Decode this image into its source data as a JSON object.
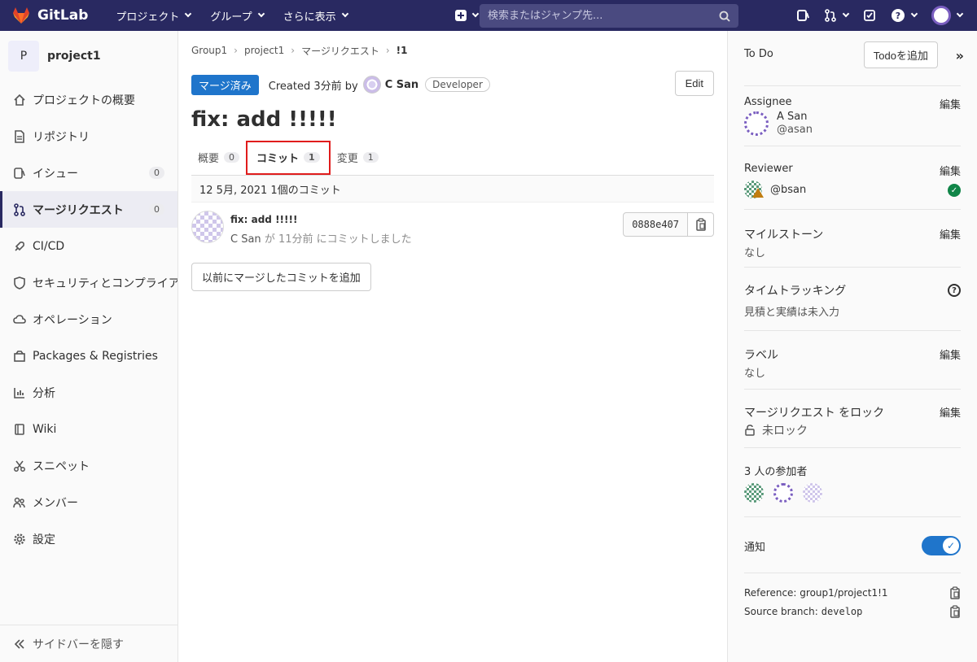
{
  "navbar": {
    "brand": "GitLab",
    "menu": [
      {
        "label": "プロジェクト"
      },
      {
        "label": "グループ"
      },
      {
        "label": "さらに表示"
      }
    ],
    "search_placeholder": "検索またはジャンプ先..."
  },
  "sidebar": {
    "project_initial": "P",
    "project_name": "project1",
    "items": [
      {
        "label": "プロジェクトの概要",
        "icon": "home-icon"
      },
      {
        "label": "リポジトリ",
        "icon": "file-icon"
      },
      {
        "label": "イシュー",
        "icon": "issues-icon",
        "badge": "0"
      },
      {
        "label": "マージリクエスト",
        "icon": "merge-request-icon",
        "badge": "0"
      },
      {
        "label": "CI/CD",
        "icon": "rocket-icon"
      },
      {
        "label": "セキュリティとコンプライアンス",
        "icon": "shield-icon"
      },
      {
        "label": "オペレーション",
        "icon": "cloud-icon"
      },
      {
        "label": "Packages & Registries",
        "icon": "package-icon"
      },
      {
        "label": "分析",
        "icon": "chart-icon"
      },
      {
        "label": "Wiki",
        "icon": "book-icon"
      },
      {
        "label": "スニペット",
        "icon": "scissors-icon"
      },
      {
        "label": "メンバー",
        "icon": "users-icon"
      },
      {
        "label": "設定",
        "icon": "gear-icon"
      }
    ],
    "collapse_label": "サイドバーを隠す"
  },
  "breadcrumb": {
    "items": [
      "Group1",
      "project1",
      "マージリクエスト"
    ],
    "current": "!1"
  },
  "mr": {
    "status": "マージ済み",
    "created_text": "Created 3分前 by",
    "author": "C San",
    "role": "Developer",
    "edit_label": "Edit",
    "title": "fix: add !!!!!"
  },
  "tabs": [
    {
      "label": "概要",
      "count": "0"
    },
    {
      "label": "コミット",
      "count": "1"
    },
    {
      "label": "変更",
      "count": "1"
    }
  ],
  "commits": {
    "header": "12 5月, 2021 1個のコミット",
    "items": [
      {
        "title": "fix: add !!!!!",
        "author": "C San",
        "by": "が",
        "time": "11分前",
        "suffix": "にコミットしました",
        "sha": "0888e407"
      }
    ],
    "add_button": "以前にマージしたコミットを追加"
  },
  "right_sidebar": {
    "todo_label": "To Do",
    "todo_button": "Todoを追加",
    "edit_label": "編集",
    "assignee_title": "Assignee",
    "assignee_name": "A San",
    "assignee_handle": "@asan",
    "reviewer_title": "Reviewer",
    "reviewer_handle": "@bsan",
    "milestone_title": "マイルストーン",
    "milestone_value": "なし",
    "time_title": "タイムトラッキング",
    "time_value": "見積と実績は未入力",
    "label_title": "ラベル",
    "label_value": "なし",
    "lock_title": "マージリクエスト をロック",
    "lock_value": "未ロック",
    "participants_title": "3 人の参加者",
    "notify_title": "通知",
    "notify_on": true,
    "reference_label": "Reference: group1/project1!1",
    "source_label": "Source branch:",
    "source_branch": "develop"
  },
  "colors": {
    "navbar": "#292961",
    "status_merged": "#1f75cb",
    "tab_highlight": "#e01c1c",
    "toggle_on": "#1f75cb",
    "check": "#108548"
  }
}
